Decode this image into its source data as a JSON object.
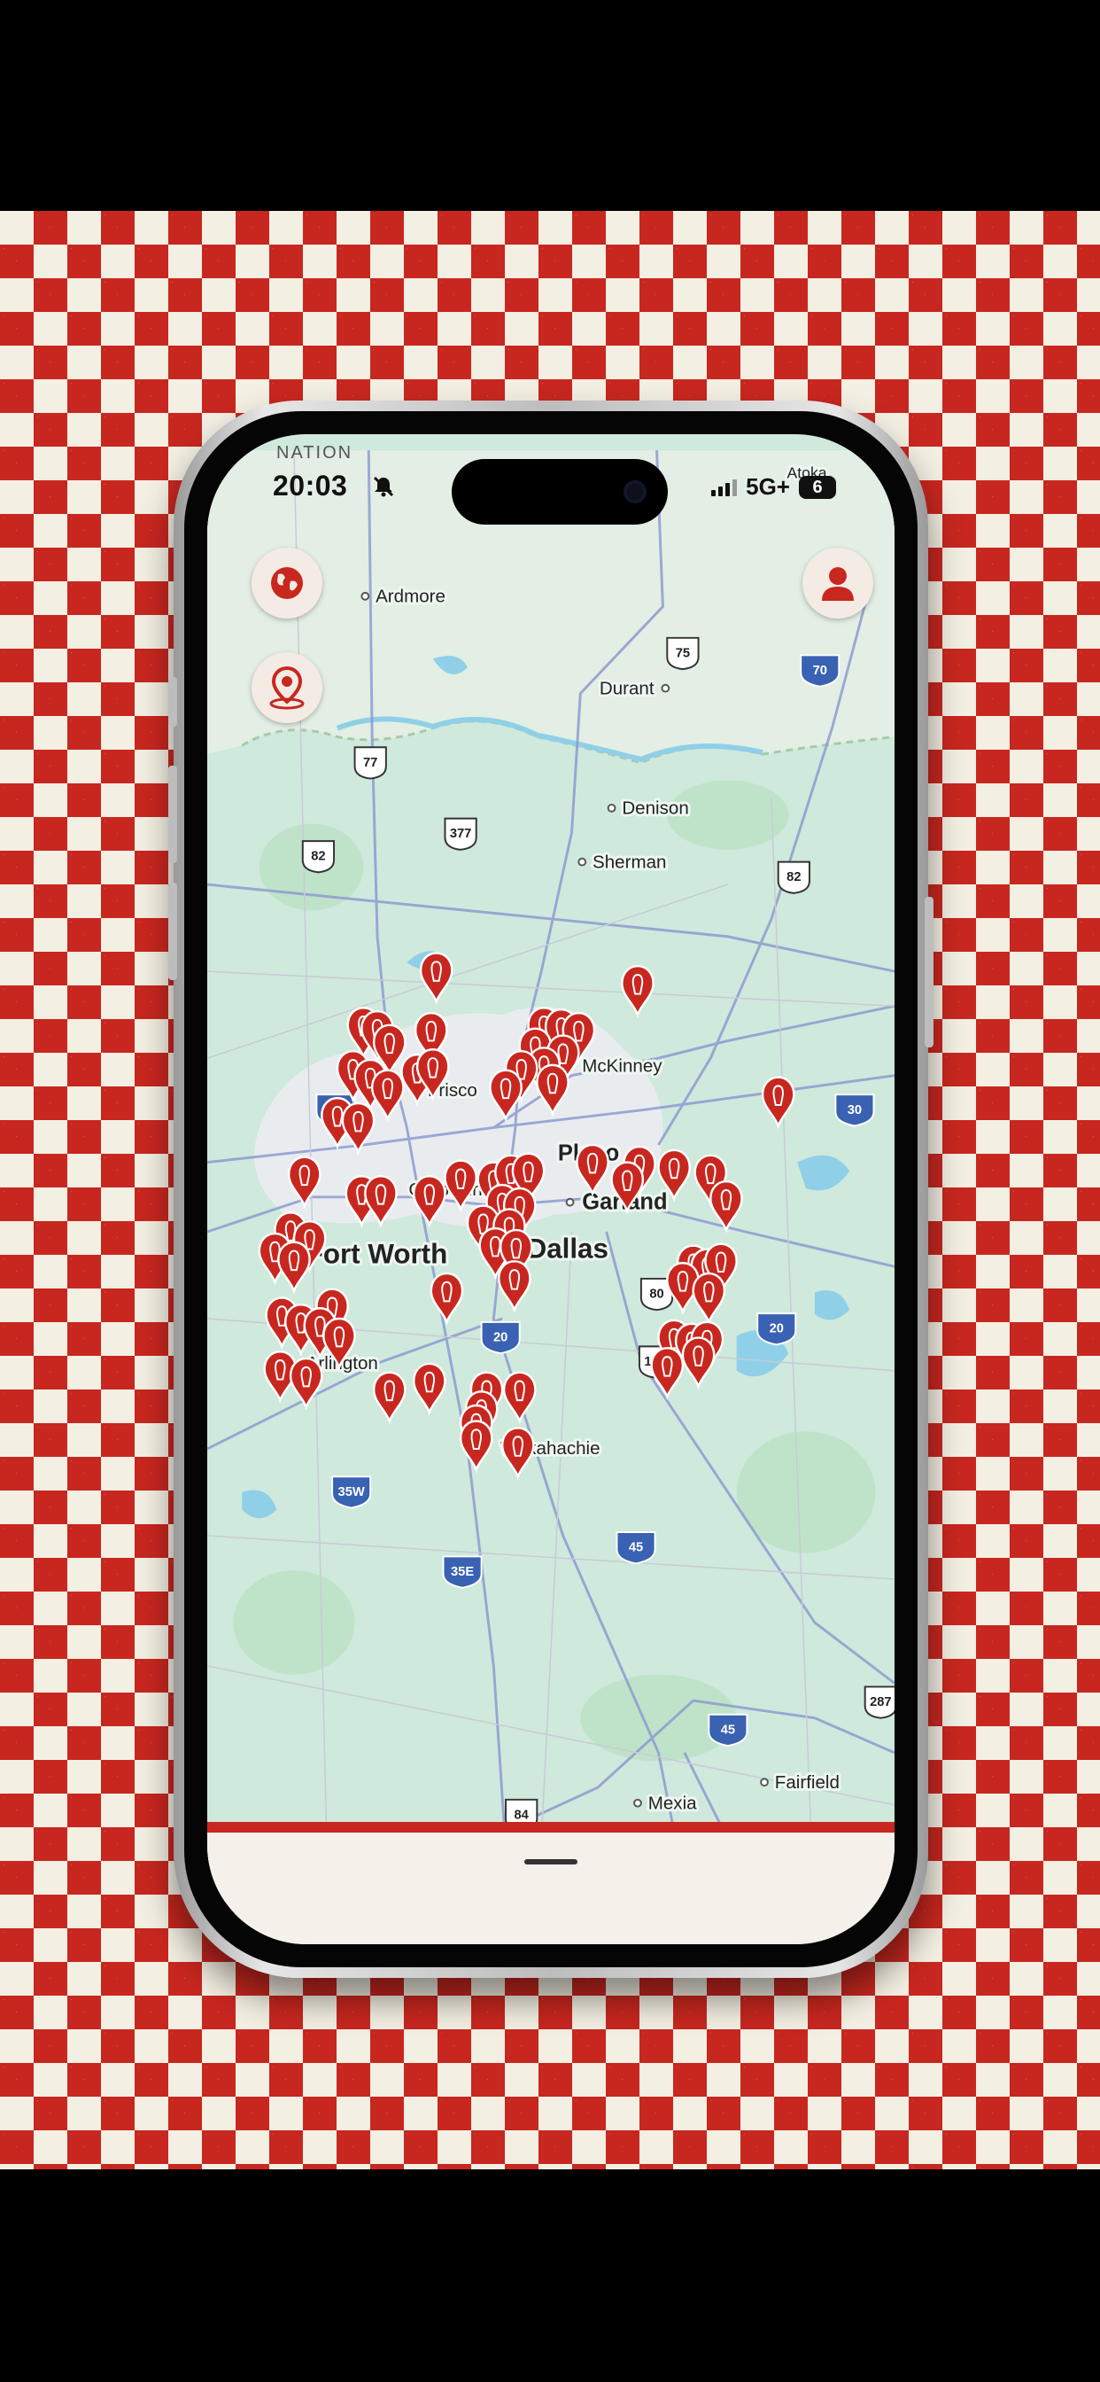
{
  "status_bar": {
    "carrier": "NATION",
    "time": "20:03",
    "network": "5G+",
    "battery": "6"
  },
  "buttons": {
    "globe_icon": "globe-icon",
    "location_icon": "location-pin-icon",
    "profile_icon": "user-icon"
  },
  "map": {
    "places": [
      "Ardmore",
      "Durant",
      "Denison",
      "Sherman",
      "McKinney",
      "Frisco",
      "Plano",
      "Garland",
      "Grapevine",
      "Fort Worth",
      "Dallas",
      "Arlington",
      "Waxahachie",
      "Mexia",
      "Fairfield",
      "Atoka"
    ],
    "highways": [
      "75",
      "70",
      "77",
      "377",
      "82",
      "82",
      "35W",
      "30",
      "80",
      "20",
      "20",
      "175",
      "35W",
      "35E",
      "45",
      "45",
      "287",
      "84"
    ],
    "marker_icon": "restaurant-marker-icon",
    "colors": {
      "marker": "#c8271f",
      "land": "#cfe9dc",
      "water": "#8fd0e8",
      "urban": "#e9ecef",
      "checker_red": "#c8271f",
      "checker_cream": "#f4efe3"
    }
  },
  "bottom_sheet": {
    "handle": "drag-handle"
  }
}
